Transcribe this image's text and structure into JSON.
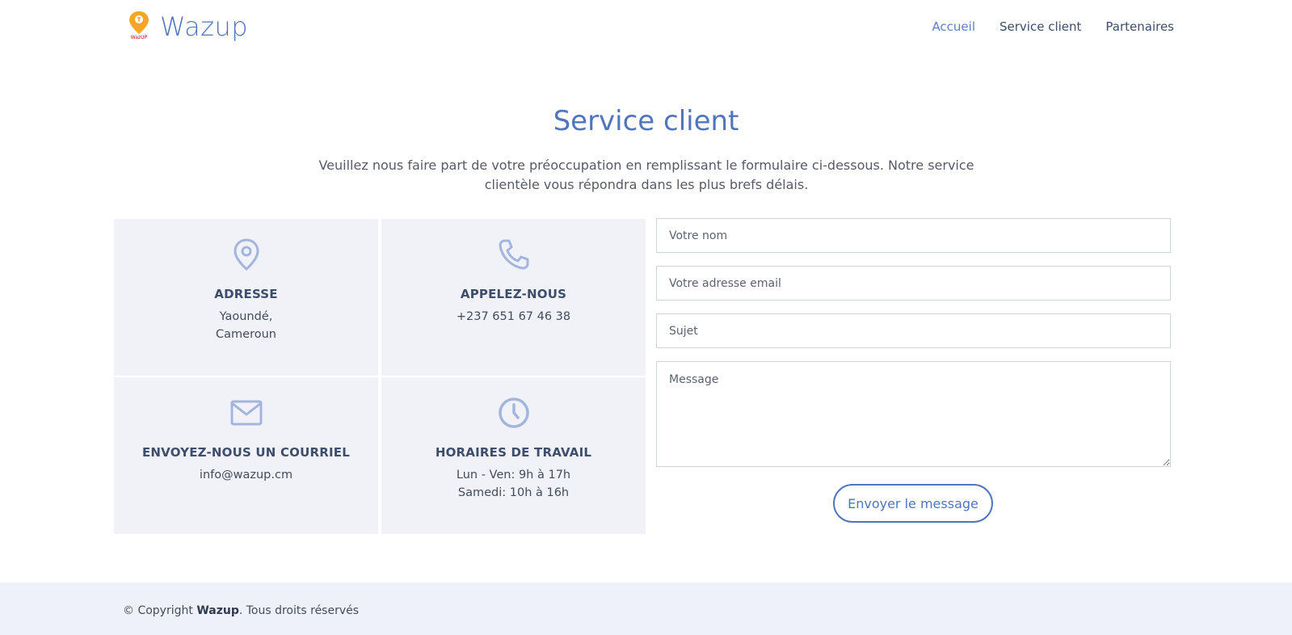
{
  "brand": {
    "name": "Wazup",
    "logo_text": "WazUP"
  },
  "nav": [
    {
      "label": "Accueil",
      "active": true
    },
    {
      "label": "Service client",
      "active": false
    },
    {
      "label": "Partenaires",
      "active": false
    }
  ],
  "section": {
    "title": "Service client",
    "description": "Veuillez nous faire part de votre préoccupation en remplissant le formulaire ci-dessous. Notre service clientèle vous répondra dans les plus brefs délais."
  },
  "info": {
    "address": {
      "icon": "map-pin-icon",
      "title": "ADRESSE",
      "line1": "Yaoundé,",
      "line2": "Cameroun"
    },
    "phone": {
      "icon": "phone-icon",
      "title": "APPELEZ-NOUS",
      "line1": "+237 651 67 46 38"
    },
    "email": {
      "icon": "envelope-icon",
      "title": "ENVOYEZ-NOUS UN COURRIEL",
      "line1": "info@wazup.cm"
    },
    "hours": {
      "icon": "clock-icon",
      "title": "HORAIRES DE TRAVAIL",
      "line1": "Lun - Ven: 9h à 17h",
      "line2": "Samedi: 10h à 16h"
    }
  },
  "form": {
    "name_placeholder": "Votre nom",
    "email_placeholder": "Votre adresse email",
    "subject_placeholder": "Sujet",
    "message_placeholder": "Message",
    "submit_label": "Envoyer le message"
  },
  "footer": {
    "prefix": "© Copyright ",
    "brand": "Wazup",
    "suffix": ". Tous droits réservés"
  },
  "colors": {
    "accent": "#5174be",
    "icon": "#a3b5dc",
    "box_bg": "#f0f2f7",
    "footer_bg": "#eef1f8",
    "logo_orange": "#f5a623"
  }
}
